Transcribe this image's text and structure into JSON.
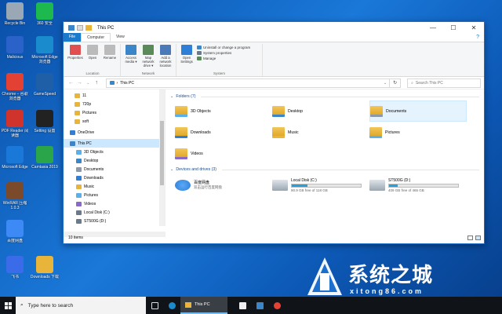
{
  "desktop": {
    "icons": [
      {
        "label": "Recycle Bin",
        "color": "#9aa7b5"
      },
      {
        "label": "360 安全",
        "color": "#1db94f"
      },
      {
        "label": "Malicious",
        "color": "#2a62c9"
      },
      {
        "label": "Microsoft Edge 浏览器",
        "color": "#1a8ccd"
      },
      {
        "label": "Chrome – 谷歌浏览器",
        "color": "#e34133"
      },
      {
        "label": "GameSpeed",
        "color": "#1f5fa8"
      },
      {
        "label": "PDF Reader 阅读器",
        "color": "#d0332b"
      },
      {
        "label": "Setting 设置",
        "color": "#222222"
      },
      {
        "label": "Microsoft Edge",
        "color": "#1a78d8"
      },
      {
        "label": "Camtasia 2019",
        "color": "#2aa54a"
      },
      {
        "label": "WinRAR 压缩 1.0.3",
        "color": "#7a4a2a"
      },
      {
        "label": "百度网盘",
        "color": "#3d8af7"
      },
      {
        "label": "飞书",
        "color": "#3a6be8"
      },
      {
        "label": "Downloads 下载",
        "color": "#e8b53a"
      }
    ]
  },
  "window": {
    "title": "This PC",
    "controls": {
      "minimize": "—",
      "maximize": "☐",
      "close": "✕"
    },
    "tabs": {
      "file": "File",
      "computer": "Computer",
      "view": "View"
    },
    "ribbon": {
      "location": {
        "name": "Location",
        "buttons": [
          {
            "label": "Properties",
            "color": "#e05050"
          },
          {
            "label": "Open",
            "color": "#bbbbbb"
          },
          {
            "label": "Rename",
            "color": "#bbbbbb"
          }
        ]
      },
      "network": {
        "name": "Network",
        "buttons": [
          {
            "label": "Access media ▾",
            "color": "#3a86c8"
          },
          {
            "label": "Map network drive ▾",
            "color": "#5a8a5a"
          },
          {
            "label": "Add a network location",
            "color": "#4a7ab8"
          }
        ]
      },
      "system": {
        "name": "System",
        "open_settings": "Open Settings",
        "items": [
          "Uninstall or change a program",
          "System properties",
          "Manage"
        ]
      }
    },
    "address": {
      "path": "This PC",
      "search_placeholder": "Search This PC"
    },
    "nav": {
      "items": [
        {
          "label": "11",
          "kind": "folder",
          "color": "#e8b53a"
        },
        {
          "label": "720p",
          "kind": "folder",
          "color": "#e8b53a"
        },
        {
          "label": "Pictures",
          "kind": "folder",
          "color": "#e8b53a"
        },
        {
          "label": "soft",
          "kind": "folder",
          "color": "#e8b53a"
        },
        {
          "label": "OneDrive",
          "kind": "cloud",
          "color": "#2f7fd6"
        },
        {
          "label": "This PC",
          "kind": "pc",
          "color": "#3a86c8"
        },
        {
          "label": "3D Objects",
          "kind": "folder",
          "color": "#5ab0e8"
        },
        {
          "label": "Desktop",
          "kind": "folder",
          "color": "#3a86c8"
        },
        {
          "label": "Documents",
          "kind": "folder",
          "color": "#8a9aaa"
        },
        {
          "label": "Downloads",
          "kind": "folder",
          "color": "#2f7fd6"
        },
        {
          "label": "Music",
          "kind": "folder",
          "color": "#e8b53a"
        },
        {
          "label": "Pictures",
          "kind": "folder",
          "color": "#5ab0e8"
        },
        {
          "label": "Videos",
          "kind": "folder",
          "color": "#8a6ac8"
        },
        {
          "label": "Local Disk (C:)",
          "kind": "drive",
          "color": "#6a7a8a"
        },
        {
          "label": "ST500G (D:)",
          "kind": "drive",
          "color": "#6a7a8a"
        }
      ]
    },
    "folders_header": "Folders (7)",
    "folders": [
      {
        "label": "3D Objects",
        "color": "#5ab0e8"
      },
      {
        "label": "Desktop",
        "color": "#3a86c8"
      },
      {
        "label": "Documents",
        "color": "#8a9aaa"
      },
      {
        "label": "Downloads",
        "color": "#2f7fd6"
      },
      {
        "label": "Music",
        "color": "#e8b53a"
      },
      {
        "label": "Pictures",
        "color": "#5ab0e8"
      },
      {
        "label": "Videos",
        "color": "#8a6ac8"
      }
    ],
    "drives_header": "Devices and drives (3)",
    "drives": [
      {
        "label": "百度网盘",
        "sub": "双击运行百度网盘",
        "kind": "app",
        "fill": null
      },
      {
        "label": "Local Disk (C:)",
        "sub": "90.9 GB free of 118 GB",
        "kind": "drive",
        "fill": 0.23
      },
      {
        "label": "ST500G (D:)",
        "sub": "409 GB free of 465 GB",
        "kind": "drive",
        "fill": 0.12
      }
    ],
    "status": "10 items"
  },
  "watermark": {
    "title": "系统之城",
    "url": "xitong86.com"
  },
  "taskbar": {
    "search_placeholder": "Type here to search",
    "active_app": "This PC"
  },
  "colors": {
    "accent": "#1979ca",
    "selection": "#cce8ff",
    "drive_fill": "#26a0da"
  }
}
